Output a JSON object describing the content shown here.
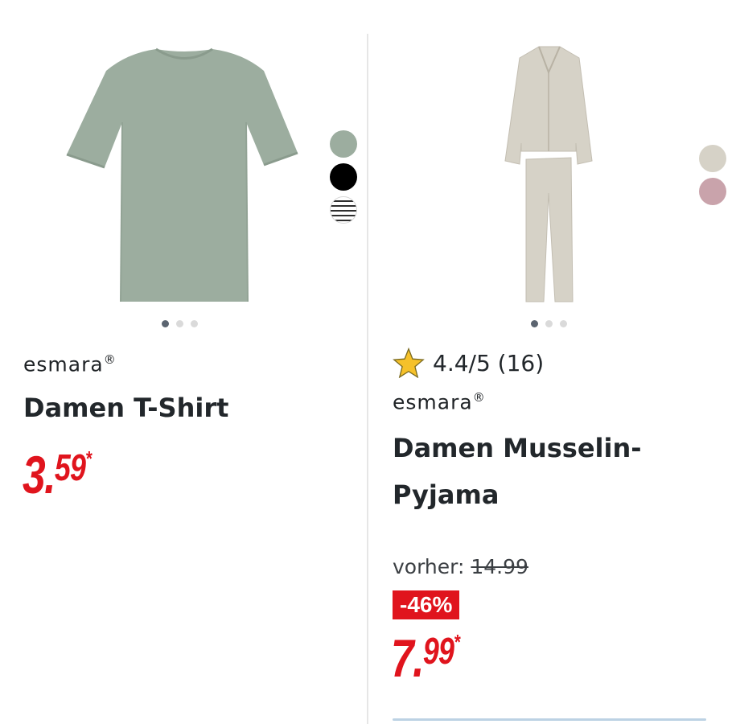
{
  "products": [
    {
      "brand": "esmara",
      "brand_mark": "®",
      "title_lines": [
        "Damen T-Shirt"
      ],
      "price": {
        "main": "3.",
        "decimals": "59",
        "asterisk": "*"
      },
      "swatch_colors": [
        "#9cad9f",
        "#000000",
        "striped"
      ],
      "carousel": {
        "count": 3,
        "active": 1
      },
      "image_icon": "green-tshirt"
    },
    {
      "rating": {
        "text": "4.4/5 (16)",
        "icon": "star-icon"
      },
      "brand": "esmara",
      "brand_mark": "®",
      "title_lines": [
        "Damen Musselin-",
        "Pyjama"
      ],
      "previous_price": {
        "label": "vorher:",
        "value": "14.99"
      },
      "discount_badge": "-46%",
      "price": {
        "main": "7.",
        "decimals": "99",
        "asterisk": "*"
      },
      "swatch_colors": [
        "#d6d2c7",
        "#c9a3ab"
      ],
      "carousel": {
        "count": 3,
        "active": 1
      },
      "image_icon": "beige-pyjama"
    }
  ],
  "colors": {
    "price_red": "#e0141d",
    "star_yellow": "#f6c12a"
  }
}
